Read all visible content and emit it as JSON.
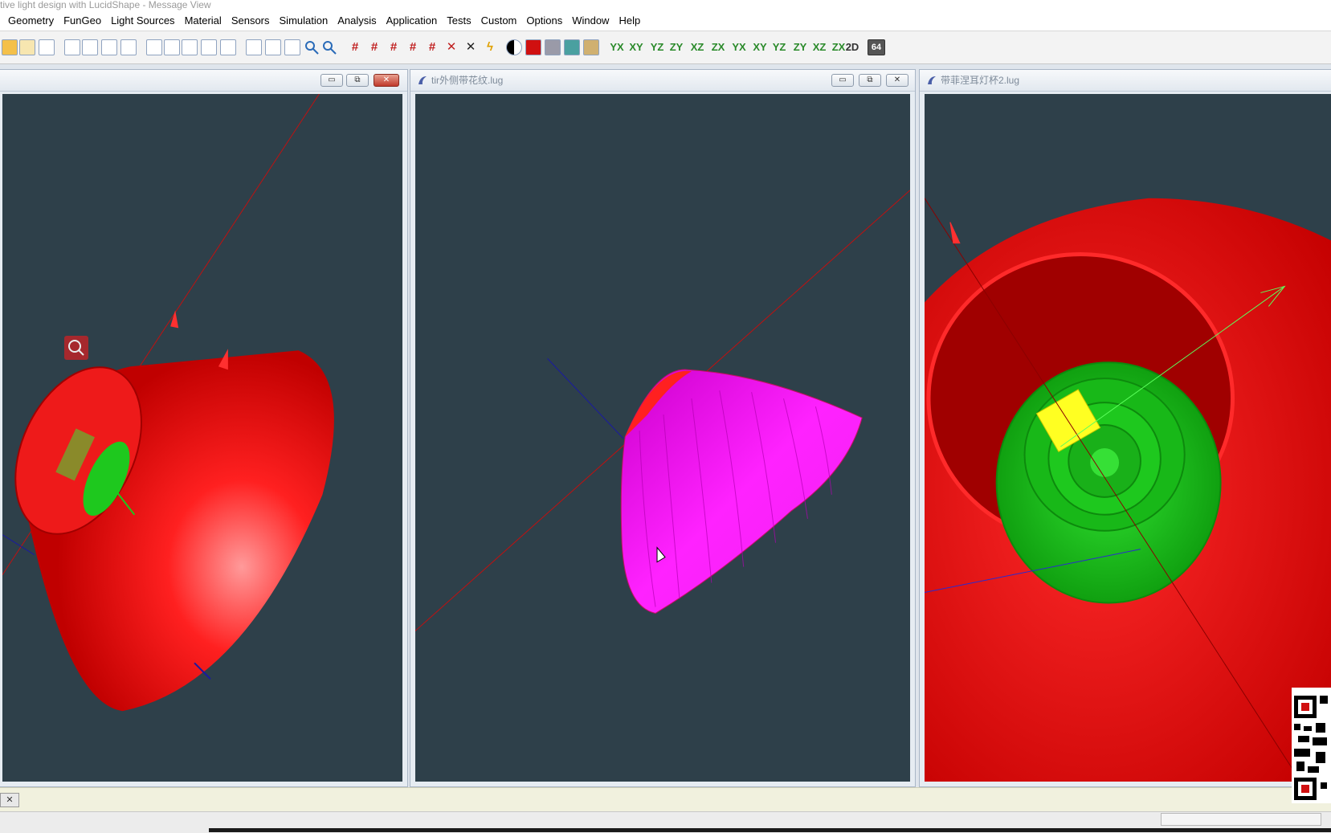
{
  "window": {
    "title": "ctive light design with LucidShape - Message View"
  },
  "menubar": {
    "items": [
      "Geometry",
      "FunGeo",
      "Light Sources",
      "Material",
      "Sensors",
      "Simulation",
      "Analysis",
      "Application",
      "Tests",
      "Custom",
      "Options",
      "Window",
      "Help"
    ]
  },
  "toolbar": {
    "label_2d": "2D",
    "label_64": "64",
    "axis_labels": [
      "YX",
      "XY",
      "YZ",
      "ZY",
      "XZ",
      "ZX",
      "YX",
      "XY",
      "YZ",
      "ZY",
      "XZ",
      "ZX"
    ]
  },
  "documents": [
    {
      "title": "",
      "close_style": "active"
    },
    {
      "title": "tir外侧带花纹.lug",
      "close_style": "inactive"
    },
    {
      "title": "带菲涅耳灯杯2.lug",
      "close_style": "inactive"
    }
  ],
  "window_buttons": {
    "minimize": "▭",
    "restore": "⧉",
    "close": "✕"
  },
  "status": {
    "close_glyph": "✕"
  },
  "colors": {
    "viewport_bg": "#2e404a",
    "red_shape": "#ff2020",
    "magenta_shape": "#ff22ff",
    "green_shape": "#1ec81e",
    "yellow_shape": "#ffff22"
  },
  "icons": {
    "search_badge": "search-icon",
    "qr": "qr-code-icon"
  }
}
